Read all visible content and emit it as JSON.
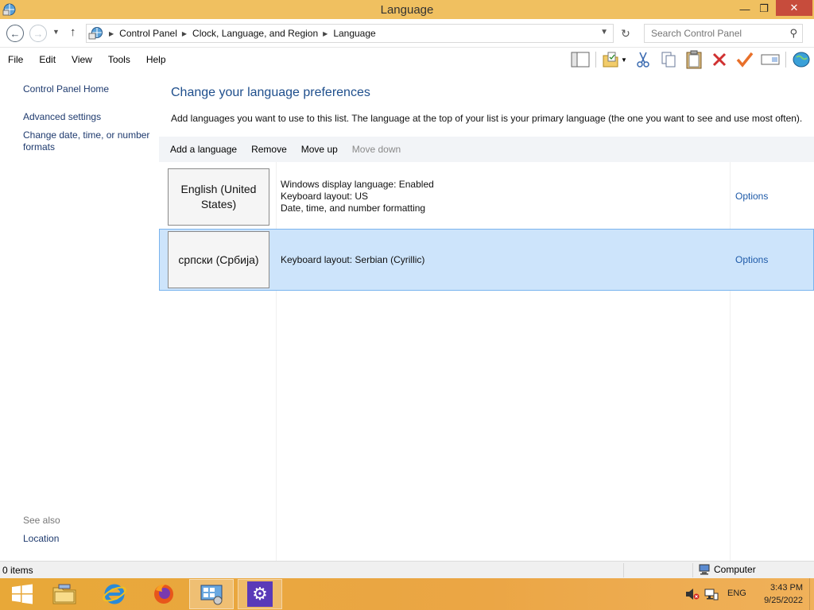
{
  "window": {
    "title": "Language",
    "minimize_glyph": "—",
    "maximize_glyph": "❐",
    "close_glyph": "✕"
  },
  "address": {
    "crumbs": [
      "Control Panel",
      "Clock, Language, and Region",
      "Language"
    ],
    "search_placeholder": "Search Control Panel"
  },
  "menu": {
    "items": [
      "File",
      "Edit",
      "View",
      "Tools",
      "Help"
    ]
  },
  "toolbar": {
    "icons": [
      "layout-pane-icon",
      "properties-folder-icon",
      "cut-icon",
      "copy-icon",
      "paste-icon",
      "delete-icon",
      "checkmark-icon",
      "rename-icon",
      "globe-icon"
    ]
  },
  "left_pane": {
    "home": "Control Panel Home",
    "advanced": "Advanced settings",
    "date_formats_line1": "Change date, time, or number",
    "date_formats_line2": "formats",
    "see_also": "See also",
    "location": "Location"
  },
  "main": {
    "title": "Change your language preferences",
    "description": "Add languages you want to use to this list. The language at the top of your list is your primary language (the one you want to see and use most often).",
    "commands": {
      "add": "Add a language",
      "remove": "Remove",
      "move_up": "Move up",
      "move_down": "Move down"
    },
    "languages": [
      {
        "name_line1": "English (United",
        "name_line2": "States)",
        "info1": "Windows display language: Enabled",
        "info2": "Keyboard layout: US",
        "info3": "Date, time, and number formatting",
        "options": "Options",
        "selected": false
      },
      {
        "name_line1": "српски (Србија)",
        "info1": "Keyboard layout: Serbian (Cyrillic)",
        "options": "Options",
        "selected": true
      }
    ]
  },
  "status": {
    "items": "0 items",
    "location": "Computer"
  },
  "taskbar": {
    "lang": "ENG",
    "time": "3:43 PM",
    "date": "9/25/2022"
  },
  "colors": {
    "title_bar": "#f0c060",
    "taskbar": "#e8a838",
    "link": "#1e3a6e",
    "heading": "#1e4e8c",
    "selection": "#cde4fb",
    "close_button": "#c74c3c"
  }
}
